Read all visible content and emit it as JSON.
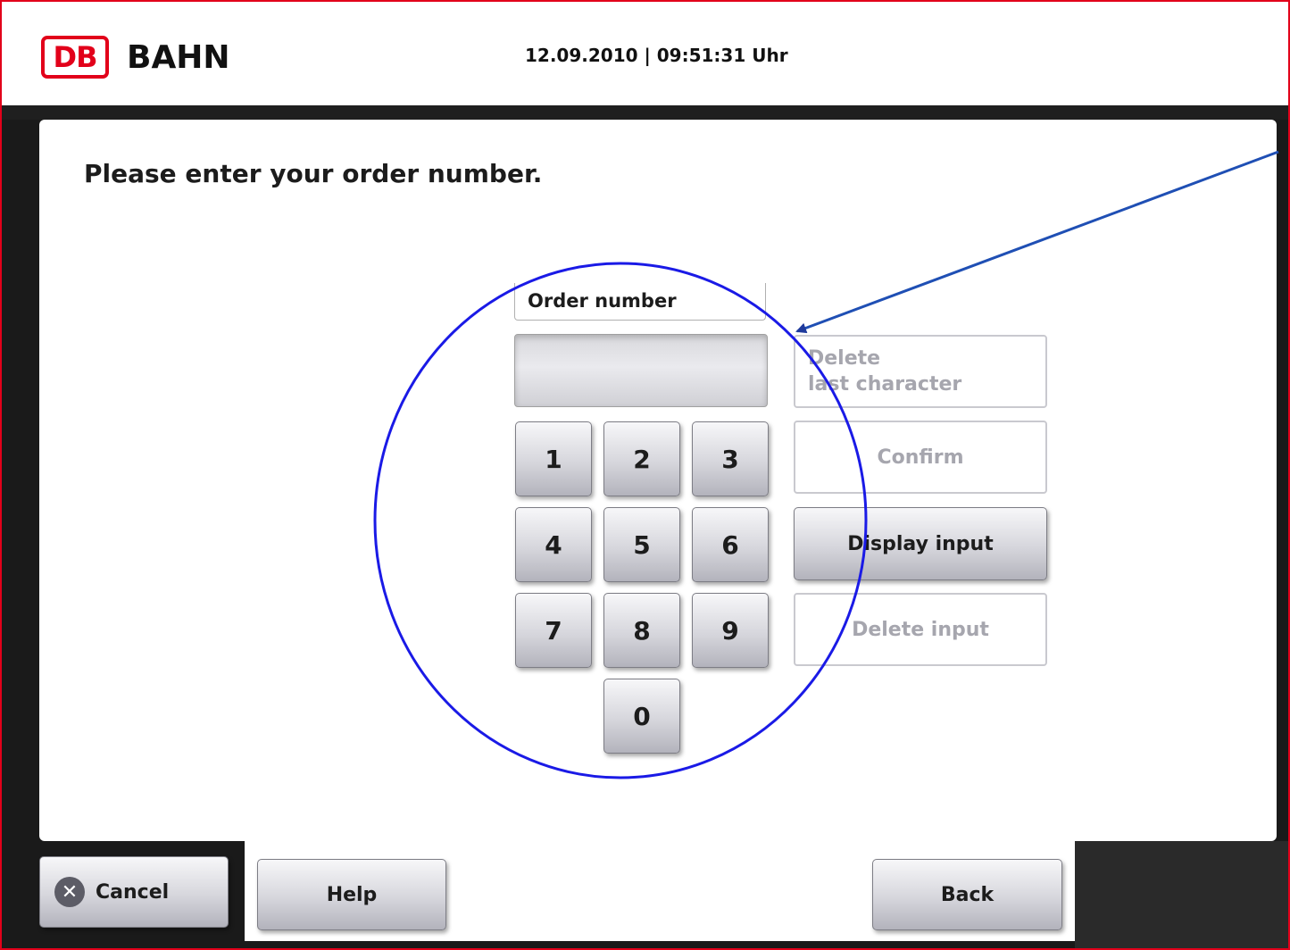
{
  "header": {
    "logo_mark": "DB",
    "logo_text": "BAHN",
    "datetime": "12.09.2010 | 09:51:31 Uhr"
  },
  "main": {
    "prompt": "Please enter your order number.",
    "field": {
      "label": "Order number",
      "value": ""
    },
    "keypad": [
      "1",
      "2",
      "3",
      "4",
      "5",
      "6",
      "7",
      "8",
      "9",
      "0"
    ],
    "actions": {
      "delete_last_line1": "Delete",
      "delete_last_line2": "last character",
      "confirm": "Confirm",
      "display_input": "Display input",
      "delete_input": "Delete input"
    }
  },
  "footer": {
    "cancel": "Cancel",
    "help": "Help",
    "back": "Back"
  },
  "colors": {
    "brand_red": "#e2001a",
    "annotation_blue": "#1a1ae6"
  },
  "icons": {
    "cancel": "close-circle-icon"
  }
}
